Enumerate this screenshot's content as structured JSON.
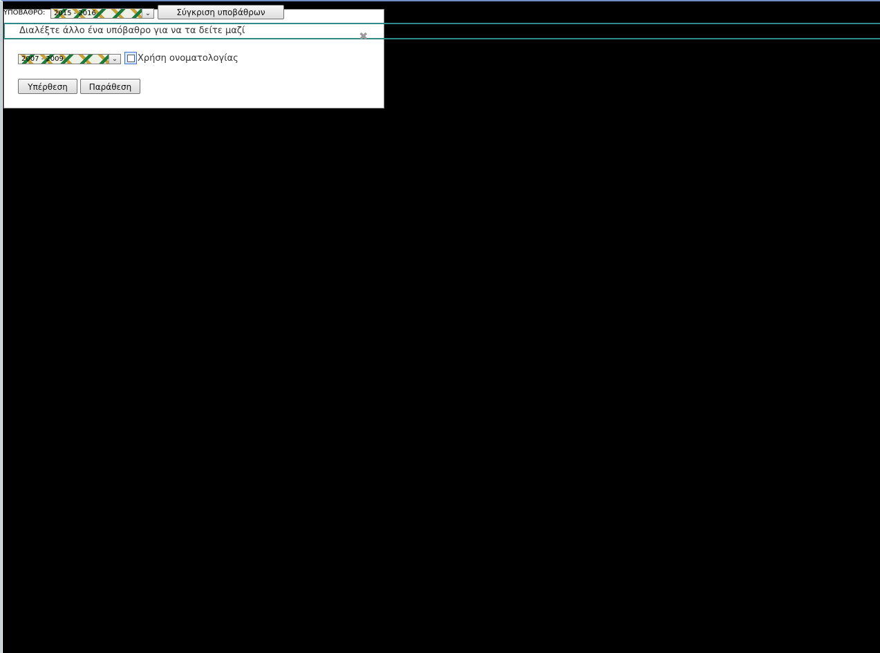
{
  "toolbar": {
    "basemap_label": "ΥΠΟΒΑΘΡΟ:",
    "basemap_selected": "2015 - 2016",
    "compare_button_label": "Σύγκριση υποβάθρων"
  },
  "compare_panel": {
    "header_text": "Διαλέξτε άλλο ένα υπόβαθρο για να τα δείτε μαζί",
    "second_basemap_selected": "2007 - 2009",
    "naming_checkbox_label": "Χρήση ονοματολογίας",
    "naming_checked": false,
    "overlay_button_label": "Υπέρθεση",
    "side_by_side_button_label": "Παράθεση"
  },
  "icons": {
    "close": "close-icon",
    "dropdown": "chevron-down-icon"
  },
  "colors": {
    "background": "#000000",
    "panel_header_border": "#2e8a8a",
    "checkbox_accent": "#3b6fd0"
  }
}
